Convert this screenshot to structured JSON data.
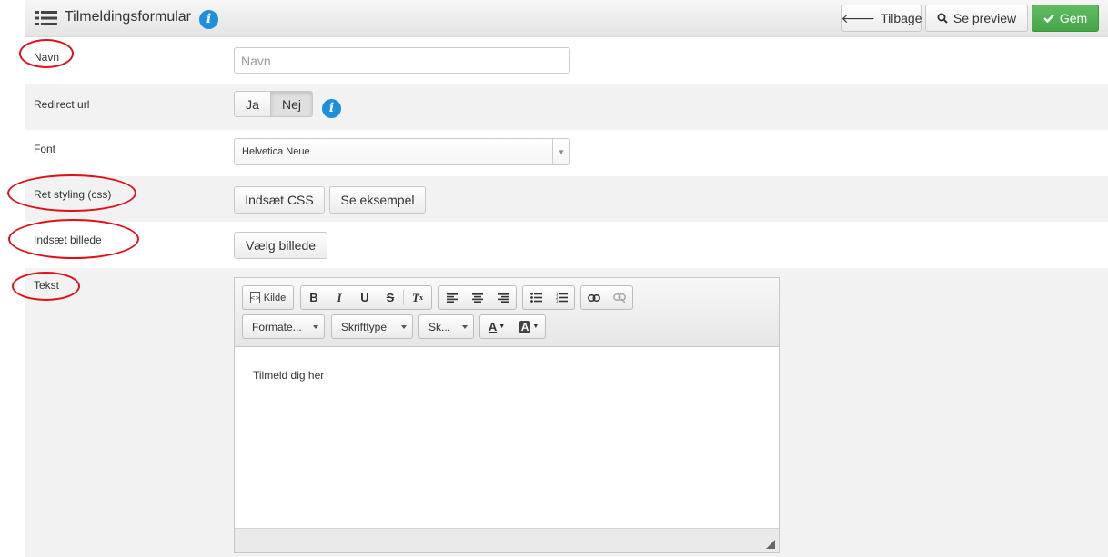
{
  "header": {
    "title": "Tilmeldingsformular",
    "info_icon": "info-icon",
    "buttons": {
      "back": "Tilbage",
      "preview": "Se preview",
      "save": "Gem"
    }
  },
  "rows": {
    "navn": {
      "label": "Navn",
      "placeholder": "Navn",
      "value": ""
    },
    "redirect": {
      "label": "Redirect url",
      "options": [
        "Ja",
        "Nej"
      ],
      "selected": "Nej"
    },
    "font": {
      "label": "Font",
      "selected": "Helvetica Neue"
    },
    "styling": {
      "label": "Ret styling (css)",
      "buttons": [
        "Indsæt CSS",
        "Se eksempel"
      ]
    },
    "billede": {
      "label": "Indsæt billede",
      "button": "Vælg billede"
    },
    "tekst": {
      "label": "Tekst"
    }
  },
  "editor": {
    "source_label": "Kilde",
    "format_label": "Formate...",
    "font_label": "Skrifttype",
    "size_label": "Sk...",
    "content": "Tilmeld dig her"
  },
  "colors": {
    "accent": "#1e8fdc",
    "save": "#47a447",
    "annotation": "#e0101a"
  }
}
